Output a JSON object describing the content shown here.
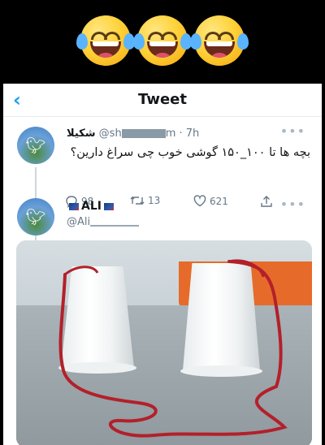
{
  "top_emojis": [
    "face-with-tears-of-joy",
    "face-with-tears-of-joy",
    "face-with-tears-of-joy"
  ],
  "header": {
    "title": "Tweet"
  },
  "tweet": {
    "display_name": "شکیلا",
    "handle_prefix": "@sh",
    "handle_suffix": "m",
    "time": "· 7h",
    "text": "بچه ها تا ۱۰۰_۱۵۰ گوشی خوب چی سراغ دارین؟",
    "replies": "98",
    "retweets": "13",
    "likes": "621"
  },
  "reply": {
    "display_name": "ALI",
    "handle_prefix": "@Ali"
  },
  "colors": {
    "accent": "#1da1f2",
    "text": "#14171a",
    "muted": "#657786",
    "string": "#b3202a"
  },
  "icons": [
    "back-icon",
    "more-icon",
    "reply-icon",
    "retweet-icon",
    "like-icon",
    "share-icon",
    "twitter-bird-icon",
    "flag-icon"
  ]
}
